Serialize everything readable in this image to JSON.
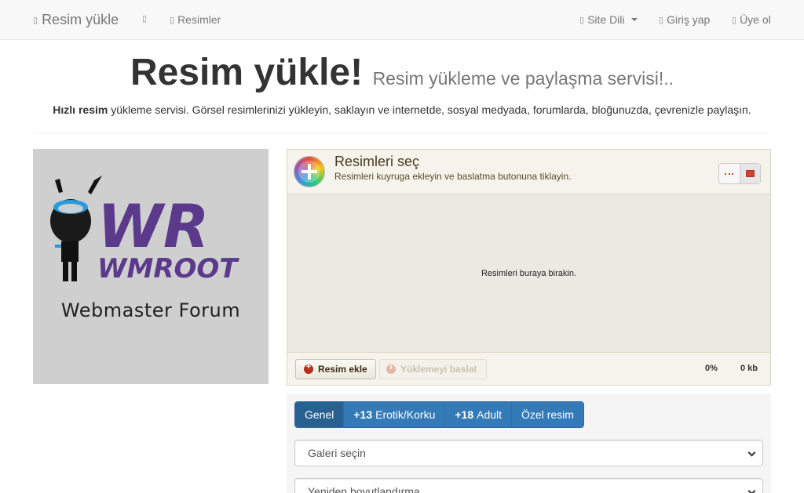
{
  "navbar": {
    "brand": "Resim yükle",
    "icon_link": "",
    "images_link": "Resimler",
    "site_lang": "Site Dili",
    "login": "Giriş yap",
    "register": "Üye ol"
  },
  "header": {
    "title": "Resim yükle!",
    "subtitle": "Resim yükleme ve paylaşma servisi!..",
    "tagline_bold": "Hızlı resim",
    "tagline_rest": " yükleme servisi. Görsel resimlerinizi yükleyin, saklayın ve internetde, sosyal medyada, forumlarda, bloğunuzda, çevrenizle paylaşın."
  },
  "logo": {
    "letters_top": "WR",
    "letters_bottom": "WMROOT",
    "caption": "Webmaster Forum"
  },
  "uploader": {
    "title": "Resimleri seç",
    "subtitle": "Resimleri kuyruga ekleyin ve baslatma butonuna tiklayin.",
    "drop_text": "Resimleri buraya birakin.",
    "add_button": "Resim ekle",
    "start_button": "Yüklemeyi baslat",
    "progress": "0%",
    "size": "0 kb"
  },
  "options": {
    "categories": [
      {
        "prefix": "",
        "label": "Genel"
      },
      {
        "prefix": "+13",
        "label": "Erotik/Korku"
      },
      {
        "prefix": "+18",
        "label": "Adult"
      },
      {
        "prefix": "",
        "label": "Özel resim"
      }
    ],
    "gallery_select": "Galeri seçin",
    "resize_select": "Yeniden boyutlandırma"
  },
  "colors": {
    "primary": "#337ab7",
    "primary_active": "#286090",
    "navbar_bg": "#f8f8f8",
    "logo_purple": "#5b3a8c",
    "logo_blue": "#2a9bd8"
  }
}
